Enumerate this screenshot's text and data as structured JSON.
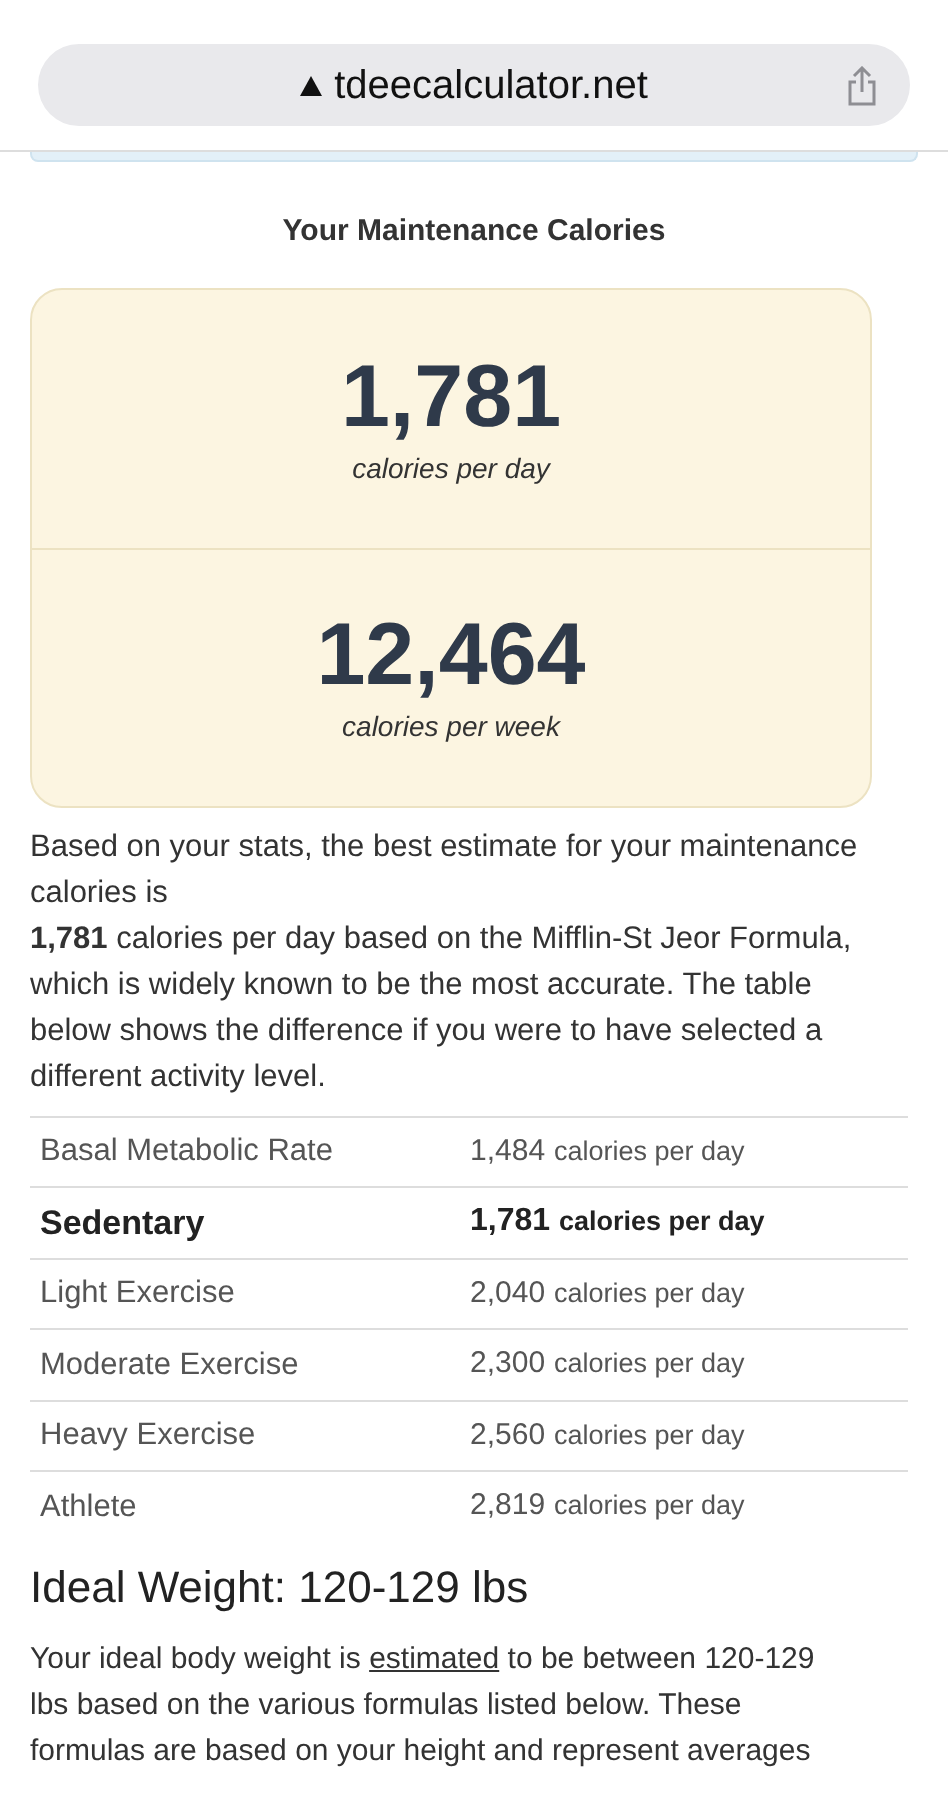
{
  "address_bar": {
    "url": "tdeecalculator.net"
  },
  "title": "Your Maintenance Calories",
  "results": [
    {
      "value": "1,781",
      "unit": "calories per day"
    },
    {
      "value": "12,464",
      "unit": "calories per week"
    }
  ],
  "summary": {
    "lines": [
      "Based on your stats, the best estimate for your maintenance calories is",
      "**1,781** calories per day based on the Mifflin-St Jeor Formula, which is widely known to be the most accurate. The table below shows the difference if you were to have selected a different activity level."
    ]
  },
  "table": {
    "rows": [
      {
        "label": "Basal Metabolic Rate",
        "value": "1,484",
        "unit": "calories per day",
        "selected": false
      },
      {
        "label": "Sedentary",
        "value": "1,781",
        "unit": "calories per day",
        "selected": true
      },
      {
        "label": "Light Exercise",
        "value": "2,040",
        "unit": "calories per day",
        "selected": false
      },
      {
        "label": "Moderate Exercise",
        "value": "2,300",
        "unit": "calories per day",
        "selected": false
      },
      {
        "label": "Heavy Exercise",
        "value": "2,560",
        "unit": "calories per day",
        "selected": false
      },
      {
        "label": "Athlete",
        "value": "2,819",
        "unit": "calories per day",
        "selected": false
      }
    ]
  },
  "ideal_weight": {
    "heading": "Ideal Weight: 120-129 lbs",
    "text_before": "Your ideal body weight is",
    "link": "estimated",
    "text_after": "to be between 120-129 lbs based on the various formulas listed below. These formulas are based on your height and represent averages"
  }
}
